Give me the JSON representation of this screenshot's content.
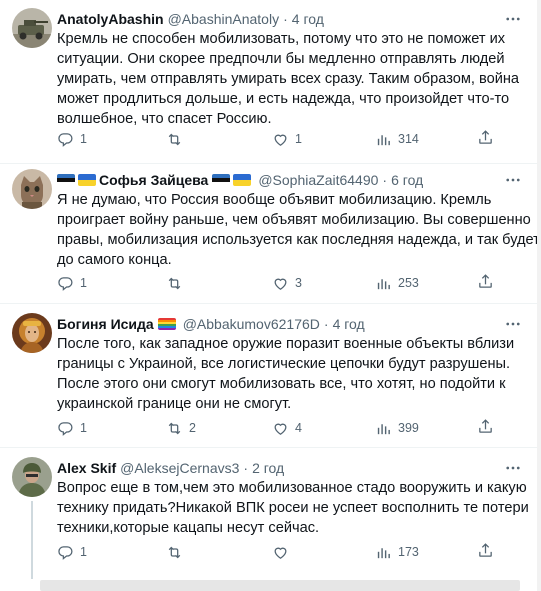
{
  "tweets": [
    {
      "name": "AnatolyAbashin",
      "handle": "@AbashinAnatoly",
      "sep": "·",
      "time": "4 год",
      "flags_before": [],
      "flags_after": [],
      "lines": [
        "Кремль не способен мобилизовать, потому что это не поможет их",
        "ситуации. Они скорее предпочли бы медленно отправлять людей",
        "умирать, чем отправлять умирать всех сразу. Таким образом, война",
        "может продлиться дольше, и есть надежда, что произойдет что-то",
        "волшебное, что спасет Россию."
      ],
      "replies": "1",
      "reposts": "",
      "likes": "1",
      "views": "314",
      "avatar": "military-vehicle"
    },
    {
      "name": "Софья Зайцева",
      "handle": "@SophiaZait64490",
      "sep": "·",
      "time": "6 год",
      "flags_before": [
        "estonia",
        "ukraine"
      ],
      "flags_after": [
        "estonia",
        "ukraine"
      ],
      "lines": [
        "Я не думаю, что Россия вообще объявит мобилизацию. Кремль",
        "проиграет войну раньше, чем объявят мобилизацию. Вы совершенно",
        "правы, мобилизация используется как последняя надежда, и так будет",
        "до самого конца."
      ],
      "replies": "1",
      "reposts": "",
      "likes": "3",
      "views": "253",
      "avatar": "cat"
    },
    {
      "name": "Богиня Исида",
      "handle": "@Abbakumov62176D",
      "sep": "·",
      "time": "4 год",
      "flags_before": [],
      "flags_after": [
        "rainbow"
      ],
      "lines": [
        "После того, как западное оружие поразит военные объекты вблизи",
        "границы с Украиной, все логистические цепочки будут разрушены.",
        "После этого они смогут мобилизовать все, что хотят, но подойти к",
        "украинской границе они не смогут."
      ],
      "replies": "1",
      "reposts": "2",
      "likes": "4",
      "views": "399",
      "avatar": "goddess"
    },
    {
      "name": "Alex Skif",
      "handle": "@AleksejCernavs3",
      "sep": "·",
      "time": "2 год",
      "flags_before": [],
      "flags_after": [],
      "lines": [
        "Вопрос еще в том,чем это мобилизованное стадо вооружить и какую",
        "технику придать?Никакой ВПК росеи не успеет восполнить те потери",
        "техники,которые кацапы несут сейчас."
      ],
      "replies": "1",
      "reposts": "",
      "likes": "",
      "views": "173",
      "avatar": "soldier"
    }
  ],
  "colors": {
    "text": "#0f1419",
    "secondary": "#536471",
    "divider": "#eff3f4",
    "thread": "#cfd9de"
  },
  "icons": [
    "reply-icon",
    "repost-icon",
    "like-icon",
    "views-icon",
    "share-icon",
    "more-icon"
  ]
}
